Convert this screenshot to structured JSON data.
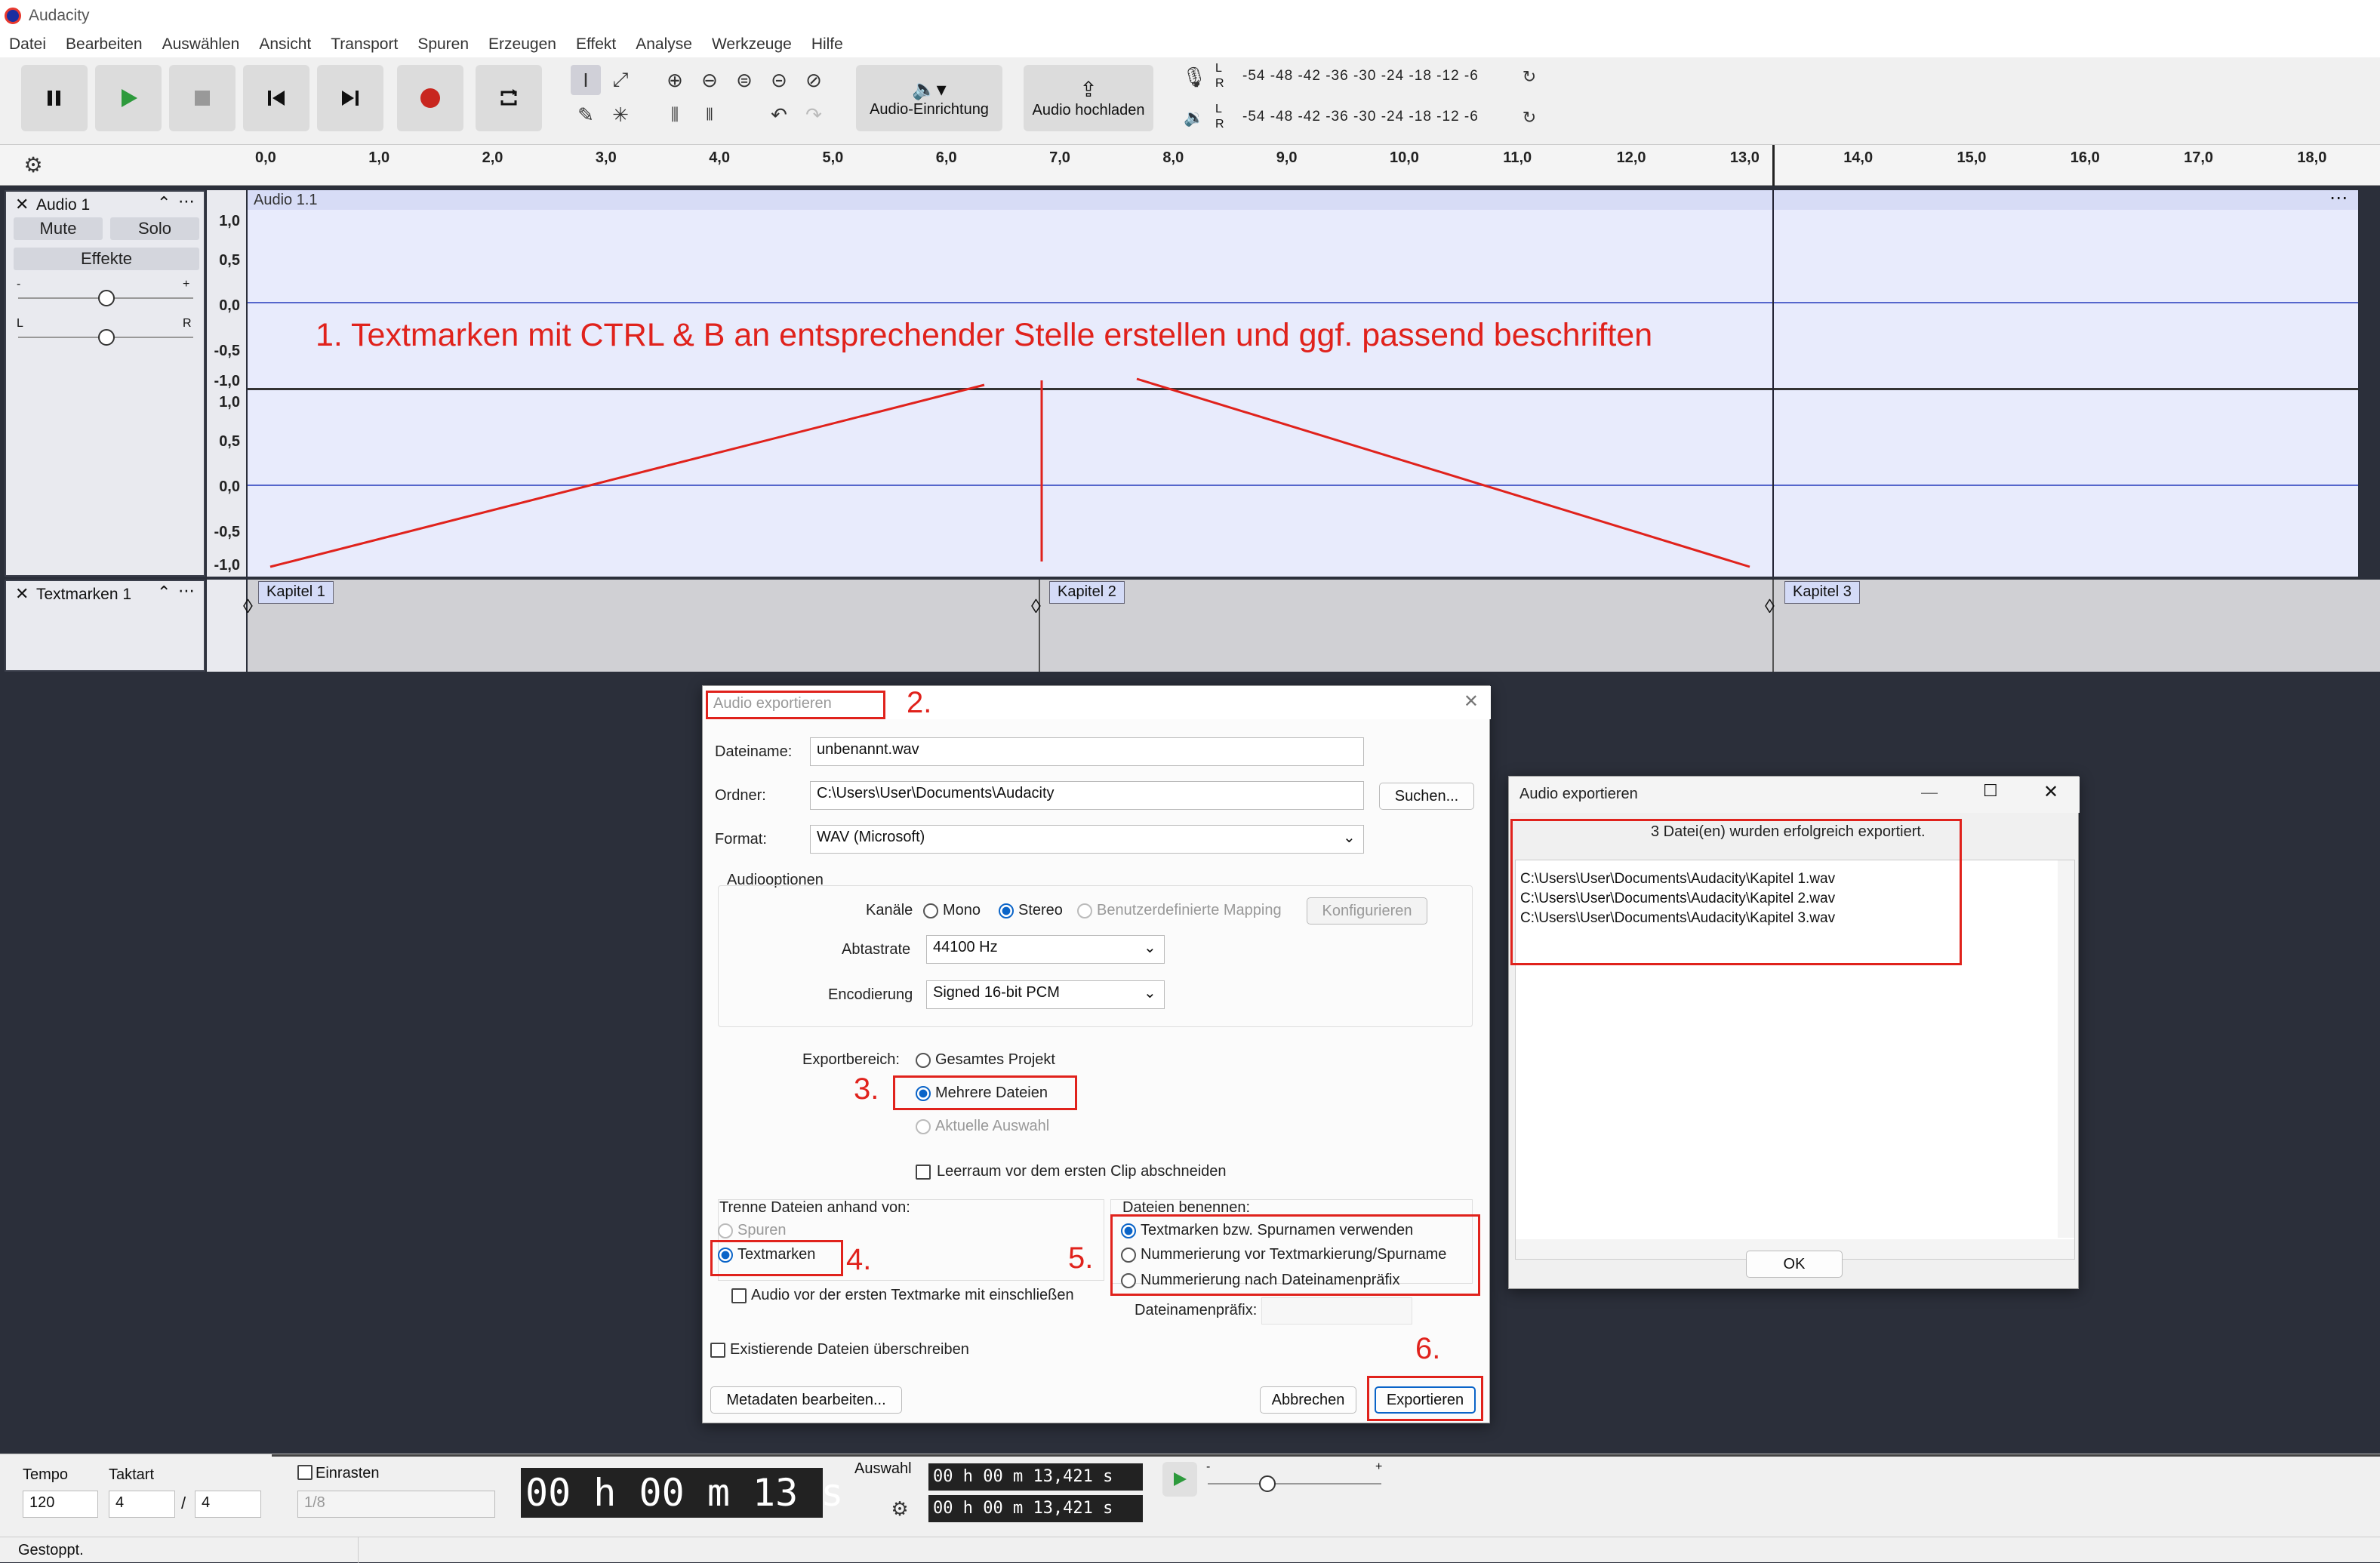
{
  "app": {
    "title": "Audacity"
  },
  "menu": [
    "Datei",
    "Bearbeiten",
    "Auswählen",
    "Ansicht",
    "Transport",
    "Spuren",
    "Erzeugen",
    "Effekt",
    "Analyse",
    "Werkzeuge",
    "Hilfe"
  ],
  "toolbar": {
    "audio_setup": "Audio-Einrichtung",
    "audio_share": "Audio hochladen",
    "meter_scale": "-54  -48  -42  -36  -30  -24  -18  -12  -6",
    "meter_l": "L",
    "meter_r": "R"
  },
  "ruler": [
    "0,0",
    "1,0",
    "2,0",
    "3,0",
    "4,0",
    "5,0",
    "6,0",
    "7,0",
    "8,0",
    "9,0",
    "10,0",
    "11,0",
    "12,0",
    "13,0",
    "14,0",
    "15,0",
    "16,0",
    "17,0",
    "18,0"
  ],
  "audio_track": {
    "name": "Audio 1",
    "mute": "Mute",
    "solo": "Solo",
    "effects": "Effekte",
    "clip_name": "Audio 1.1",
    "pan_l": "L",
    "pan_r": "R",
    "gain_minus": "-",
    "gain_plus": "+",
    "scale_upper": [
      "1,0",
      "0,5",
      "0,0",
      "-0,5",
      "-1,0"
    ],
    "scale_lower": [
      "1,0",
      "0,5",
      "0,0",
      "-0,5",
      "-1,0"
    ]
  },
  "annotation_1": "1. Textmarken mit CTRL & B an entsprechender Stelle erstellen und ggf. passend beschriften",
  "label_track": {
    "name": "Textmarken 1",
    "labels": [
      "Kapitel 1",
      "Kapitel 2",
      "Kapitel 3"
    ]
  },
  "export_dialog": {
    "title": "Audio exportieren",
    "step2": "2.",
    "filename_label": "Dateiname:",
    "filename": "unbenannt.wav",
    "folder_label": "Ordner:",
    "folder": "C:\\Users\\User\\Documents\\Audacity",
    "browse": "Suchen...",
    "format_label": "Format:",
    "format": "WAV (Microsoft)",
    "audio_options": "Audiooptionen",
    "channels_label": "Kanäle",
    "mono": "Mono",
    "stereo": "Stereo",
    "custom_mapping": "Benutzerdefinierte Mapping",
    "configure": "Konfigurieren",
    "rate_label": "Abtastrate",
    "rate": "44100 Hz",
    "encoding_label": "Encodierung",
    "encoding": "Signed 16-bit PCM",
    "range_label": "Exportbereich:",
    "whole_project": "Gesamtes Projekt",
    "multiple_files": "Mehrere Dateien",
    "current_selection": "Aktuelle Auswahl",
    "step3": "3.",
    "trim_label": "Leerraum vor dem ersten Clip abschneiden",
    "split_label": "Trenne Dateien anhand von:",
    "split_tracks": "Spuren",
    "split_labels": "Textmarken",
    "step4": "4.",
    "include_before": "Audio vor der ersten Textmarke mit einschließen",
    "naming_label": "Dateien benennen:",
    "naming_1": "Textmarken bzw. Spurnamen verwenden",
    "naming_2": "Nummerierung vor Textmarkierung/Spurname",
    "naming_3": "Nummerierung nach Dateinamenpräfix",
    "prefix_label": "Dateinamenpräfix:",
    "step5": "5.",
    "overwrite": "Existierende Dateien überschreiben",
    "metadata": "Metadaten bearbeiten...",
    "cancel": "Abbrechen",
    "export": "Exportieren",
    "step6": "6."
  },
  "result_dialog": {
    "title": "Audio exportieren",
    "message": "3 Datei(en) wurden erfolgreich exportiert.",
    "files": [
      "C:\\Users\\User\\Documents\\Audacity\\Kapitel 1.wav",
      "C:\\Users\\User\\Documents\\Audacity\\Kapitel 2.wav",
      "C:\\Users\\User\\Documents\\Audacity\\Kapitel 3.wav"
    ],
    "ok": "OK"
  },
  "bottom": {
    "tempo_label": "Tempo",
    "tempo": "120",
    "meter_label": "Taktart",
    "meter_num": "4",
    "meter_sep": "/",
    "meter_den": "4",
    "snap_label": "Einrasten",
    "snap_value": "1/8",
    "time": "00 h 00 m 13 s",
    "selection_label": "Auswahl",
    "sel_start": "00 h 00 m 13,421 s",
    "sel_end": "00 h 00 m 13,421 s",
    "speed_minus": "-",
    "speed_plus": "+"
  },
  "status": "Gestoppt."
}
